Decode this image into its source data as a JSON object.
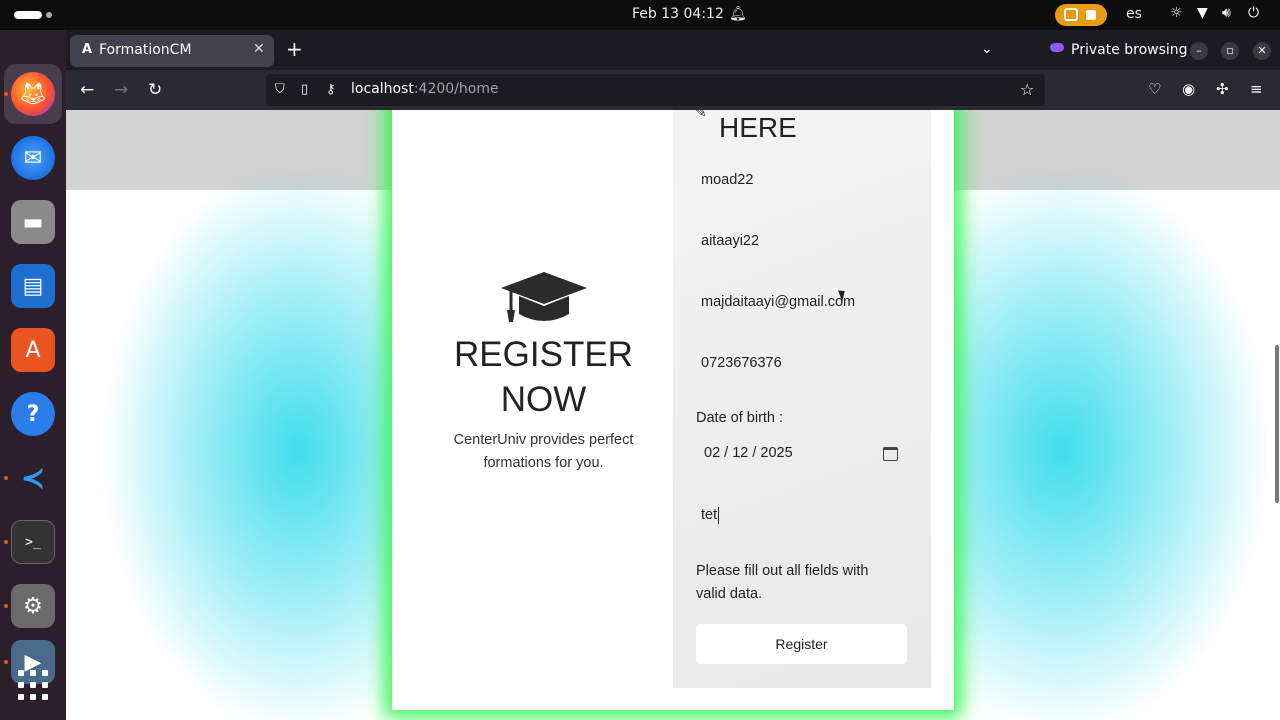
{
  "system": {
    "clock": "Feb 13  04:12",
    "language": "es"
  },
  "browser": {
    "tab_title": "FormationCM",
    "tab_favicon": "A",
    "private_label": "Private browsing",
    "url_host": "localhost",
    "url_path": ":4200/home"
  },
  "page": {
    "register_title_line1": "REGISTER",
    "register_title_line2": "NOW",
    "register_subtitle": "CenterUniv provides perfect formations for you.",
    "form_heading": "HERE",
    "fields": {
      "username": "moad22",
      "password": "aitaayi22",
      "email": "majdaitaayi@gmail.com",
      "phone": "0723676376",
      "date_label": "Date of birth :",
      "date_value": "02 / 12 / 2025",
      "last_field": "tet"
    },
    "hint": "Please fill out all fields with valid data.",
    "register_button": "Register"
  },
  "colors": {
    "card_glow": "#3df55a",
    "background_glow": "#00d2e6",
    "private_accent": "#9059ff",
    "indicator_pill": "#e69b10"
  },
  "icons": {
    "left_pane": "graduation-cap-icon",
    "date_picker": "calendar-icon"
  }
}
